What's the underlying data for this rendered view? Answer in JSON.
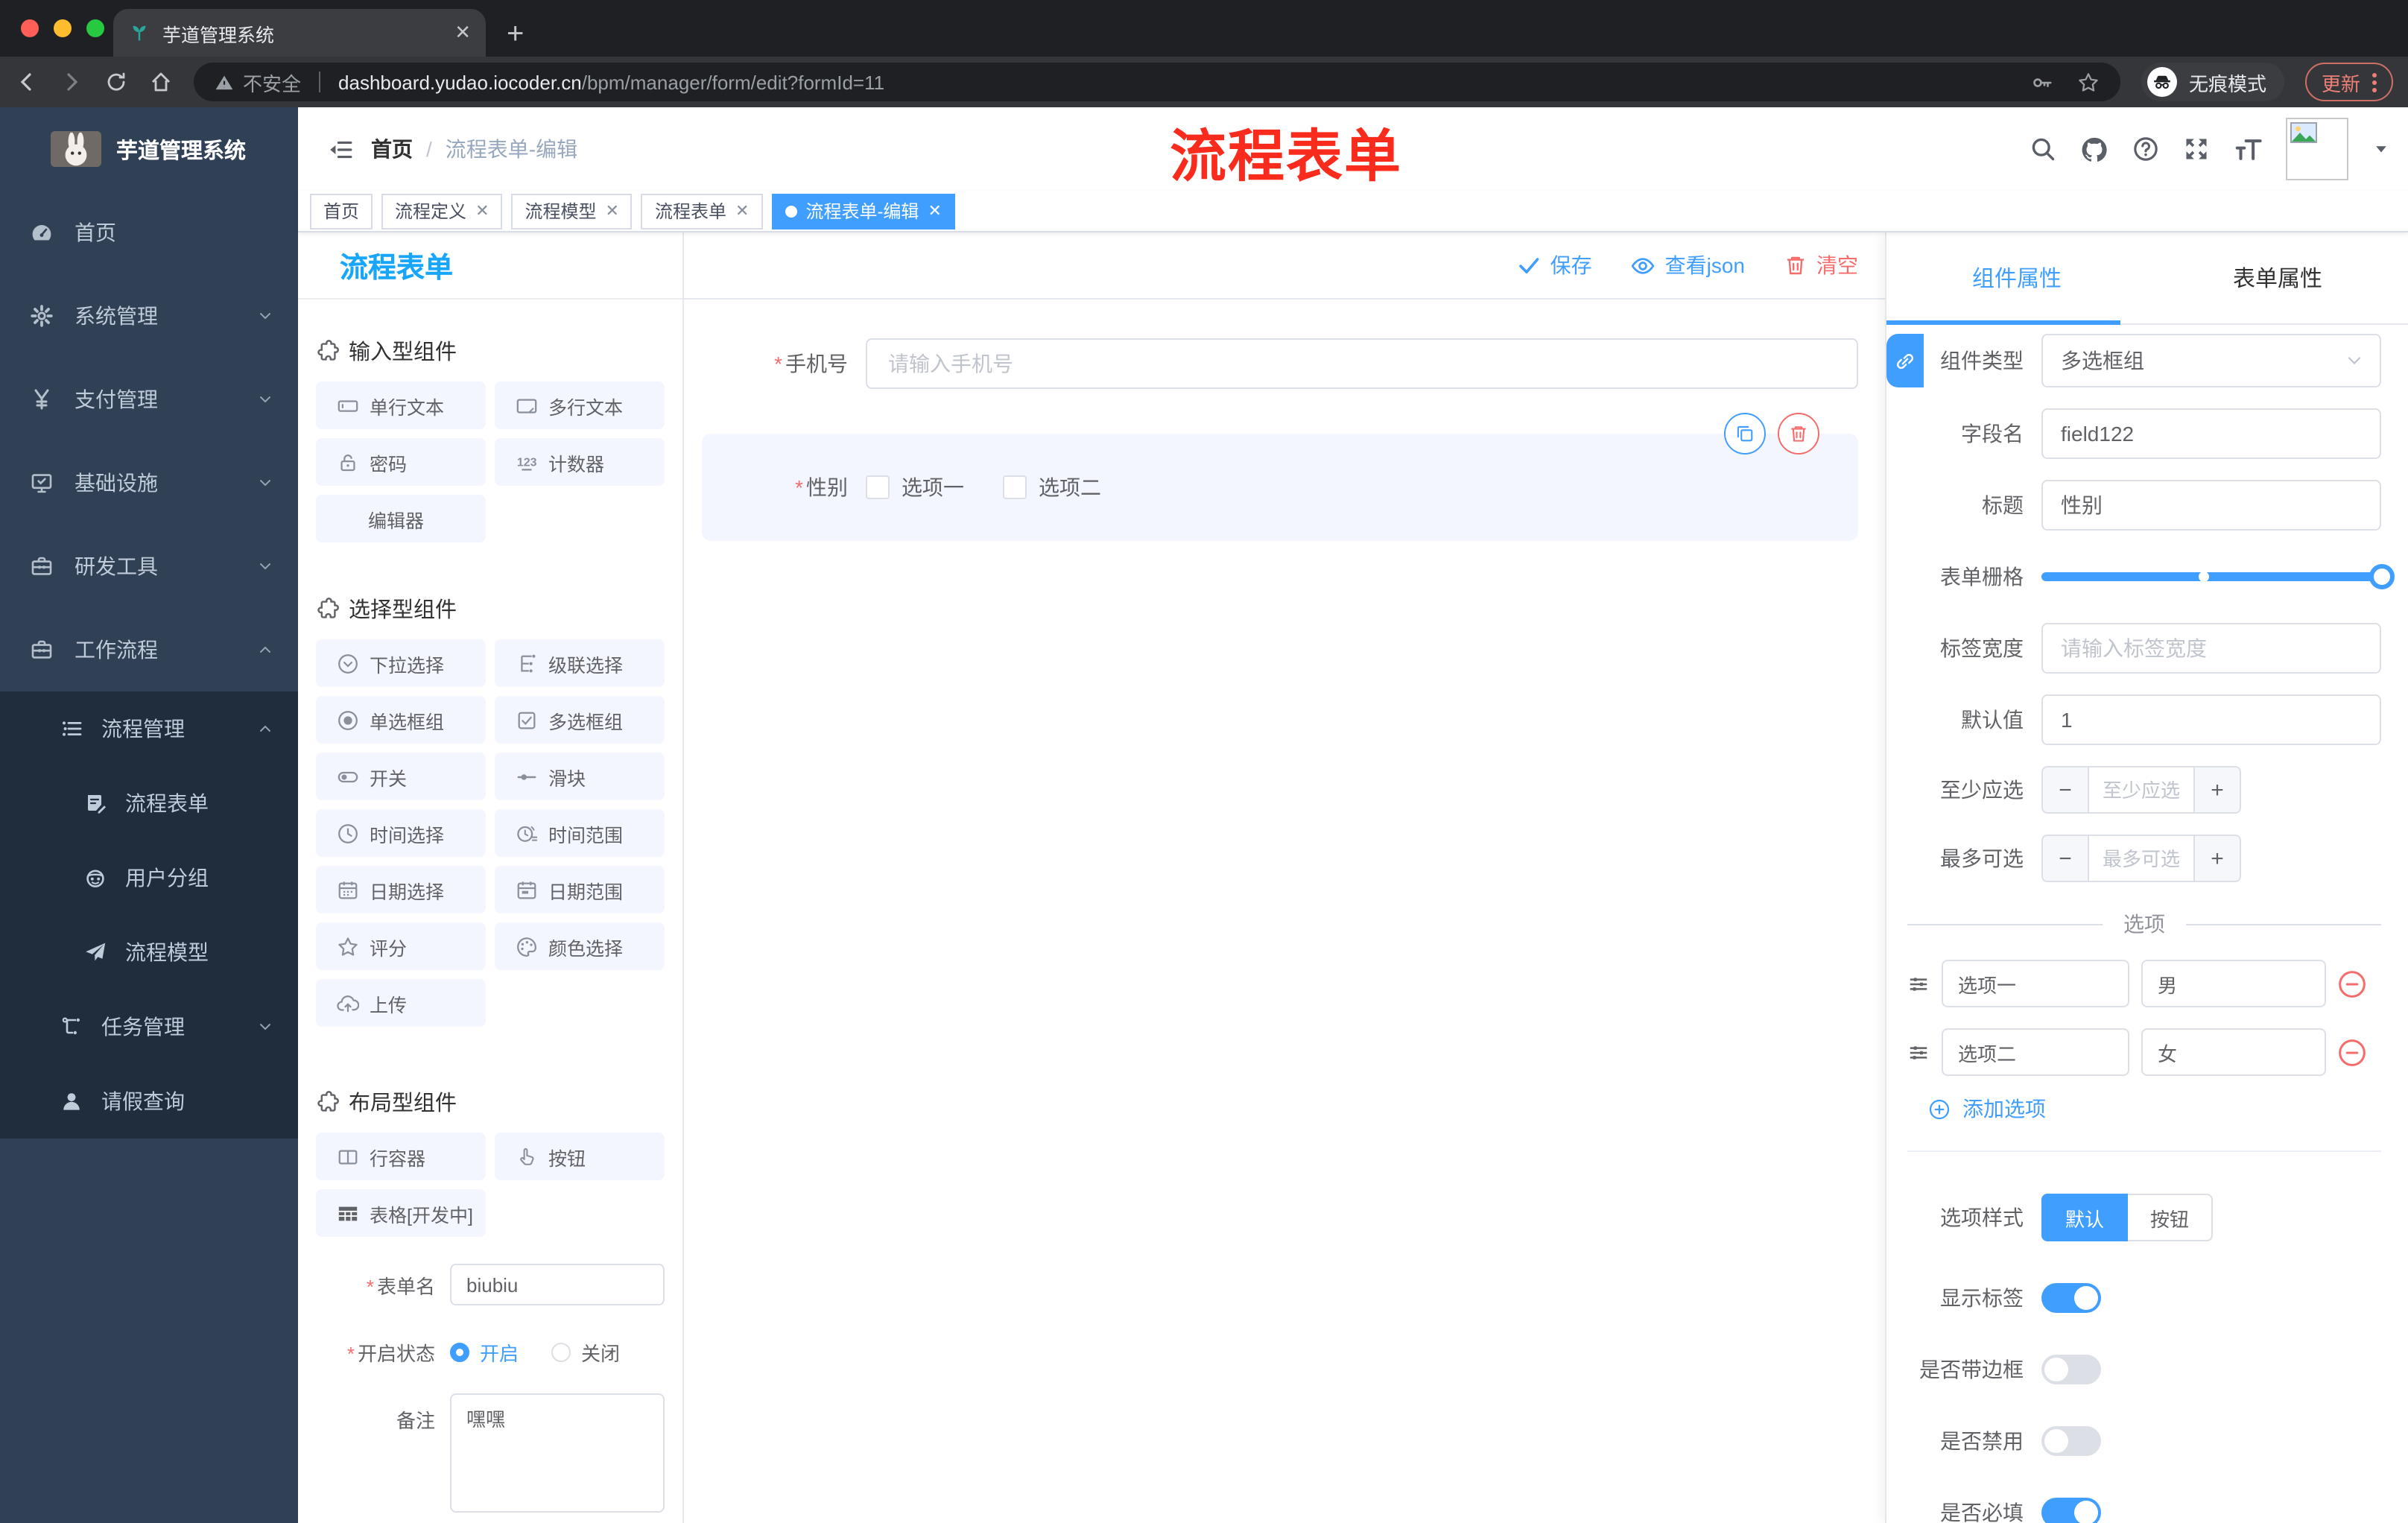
{
  "theme": {
    "accent": "#409EFF",
    "danger": "#F56C6C",
    "watermark_red": "#F92B1D",
    "sidebar_bg": "#304156",
    "submenu_bg": "#1F2D3D"
  },
  "browser": {
    "tab_title": "芋道管理系统",
    "security_label": "不安全",
    "url_domain": "dashboard.yudao.iocoder.cn",
    "url_path": "/bpm/manager/form/edit?formId=11",
    "incognito_label": "无痕模式",
    "update_label": "更新"
  },
  "sidebar": {
    "logo_title": "芋道管理系统",
    "items": [
      {
        "label": "首页"
      },
      {
        "label": "系统管理"
      },
      {
        "label": "支付管理"
      },
      {
        "label": "基础设施"
      },
      {
        "label": "研发工具"
      },
      {
        "label": "工作流程"
      }
    ],
    "submenu": {
      "label": "流程管理",
      "children": [
        {
          "label": "流程表单"
        },
        {
          "label": "用户分组"
        },
        {
          "label": "流程模型"
        }
      ]
    },
    "items_after": [
      {
        "label": "任务管理"
      },
      {
        "label": "请假查询"
      }
    ]
  },
  "header": {
    "breadcrumb": [
      "首页",
      "流程表单-编辑"
    ],
    "breadcrumb_sep": "/",
    "watermark": "流程表单"
  },
  "tags": [
    {
      "label": "首页"
    },
    {
      "label": "流程定义"
    },
    {
      "label": "流程模型"
    },
    {
      "label": "流程表单"
    },
    {
      "label": "流程表单-编辑"
    }
  ],
  "designer": {
    "panel_title": "流程表单",
    "sections": [
      {
        "title": "输入型组件",
        "items": [
          "单行文本",
          "多行文本",
          "密码",
          "计数器",
          "编辑器"
        ]
      },
      {
        "title": "选择型组件",
        "items": [
          "下拉选择",
          "级联选择",
          "单选框组",
          "多选框组",
          "开关",
          "滑块",
          "时间选择",
          "时间范围",
          "日期选择",
          "日期范围",
          "评分",
          "颜色选择",
          "上传"
        ]
      },
      {
        "title": "布局型组件",
        "items": [
          "行容器",
          "按钮",
          "表格[开发中]"
        ]
      }
    ],
    "form": {
      "name_label": "表单名",
      "name_value": "biubiu",
      "status_label": "开启状态",
      "status_on": "开启",
      "status_off": "关闭",
      "remark_label": "备注",
      "remark_value": "嘿嘿"
    }
  },
  "canvas": {
    "actions": {
      "save": "保存",
      "view_json": "查看json",
      "clear": "清空"
    },
    "phone_field": {
      "label": "手机号",
      "placeholder": "请输入手机号"
    },
    "selected_field": {
      "label": "性别",
      "option1": "选项一",
      "option2": "选项二"
    }
  },
  "inspector": {
    "tab_component": "组件属性",
    "tab_form": "表单属性",
    "type_label": "组件类型",
    "type_value": "多选框组",
    "field_label": "字段名",
    "field_value": "field122",
    "title_label": "标题",
    "title_value": "性别",
    "grid_label": "表单栅格",
    "width_label": "标签宽度",
    "width_placeholder": "请输入标签宽度",
    "default_label": "默认值",
    "default_value": "1",
    "min_label": "至少应选",
    "min_placeholder": "至少应选",
    "max_label": "最多可选",
    "max_placeholder": "最多可选",
    "options_title": "选项",
    "option_rows": [
      {
        "label": "选项一",
        "value": "男"
      },
      {
        "label": "选项二",
        "value": "女"
      }
    ],
    "add_option": "添加选项",
    "style_label": "选项样式",
    "style_default": "默认",
    "style_button": "按钮",
    "toggle_show_label": "显示标签",
    "toggle_border": "是否带边框",
    "toggle_disabled": "是否禁用",
    "toggle_required": "是否必填"
  }
}
